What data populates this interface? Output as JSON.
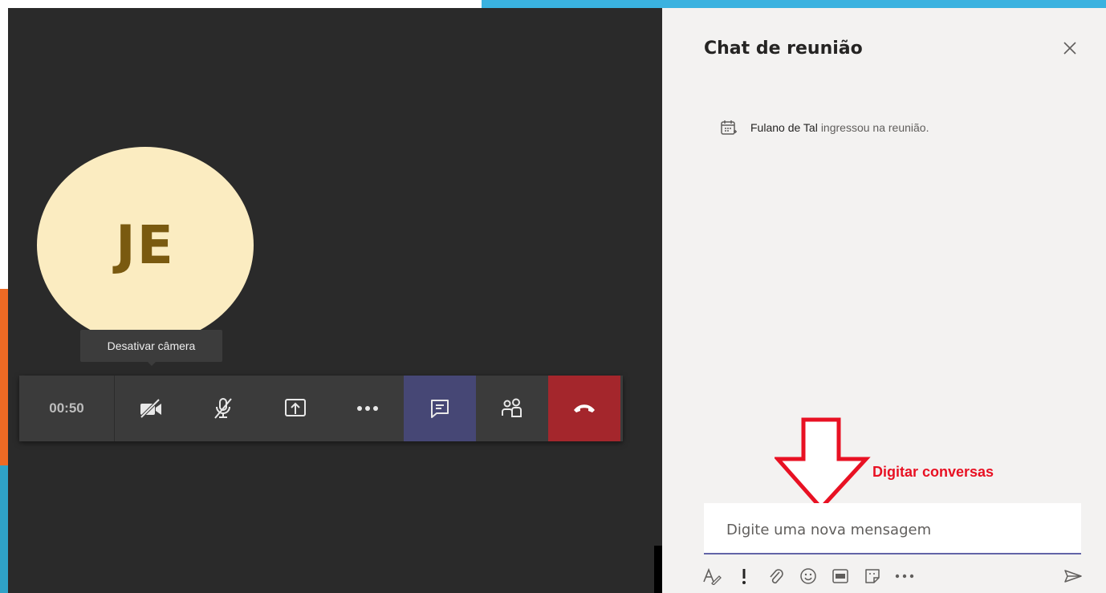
{
  "avatar": {
    "initials": "JE",
    "bg": "#fbecc1",
    "fg": "#7a5a10"
  },
  "tooltip": {
    "text": "Desativar câmera"
  },
  "toolbar": {
    "timer": "00:50",
    "buttons": [
      {
        "name": "camera-off",
        "icon": "video-off-icon"
      },
      {
        "name": "mic-off",
        "icon": "mic-off-icon"
      },
      {
        "name": "share",
        "icon": "share-screen-icon"
      },
      {
        "name": "more",
        "icon": "more-icon"
      },
      {
        "name": "chat",
        "icon": "chat-icon"
      },
      {
        "name": "participants",
        "icon": "participants-icon"
      },
      {
        "name": "hangup",
        "icon": "phone-hangup-icon"
      }
    ]
  },
  "chat": {
    "title": "Chat de reunião",
    "system_message": {
      "user": "Fulano de Tal",
      "text": "ingressou na reunião."
    },
    "compose_placeholder": "Digite uma nova mensagem",
    "format_tools": [
      "format-icon",
      "important-icon",
      "attach-icon",
      "emoji-icon",
      "gif-icon",
      "sticker-icon",
      "more-icon"
    ],
    "send_icon": "send-icon"
  },
  "annotation": {
    "text": "Digitar conversas",
    "color": "#e81123"
  }
}
